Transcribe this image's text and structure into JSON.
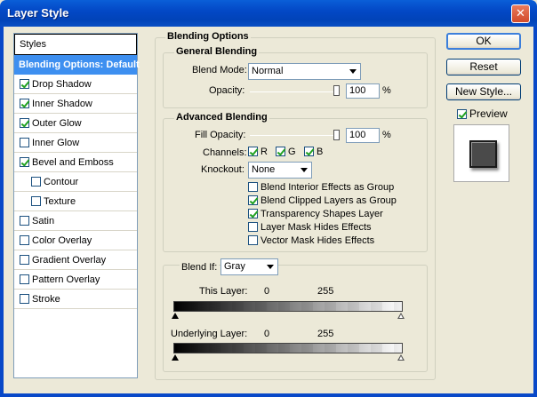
{
  "window": {
    "title": "Layer Style",
    "close_glyph": "✕"
  },
  "styles": {
    "header": "Styles",
    "items": [
      {
        "label": "Blending Options: Default",
        "selected": true
      },
      {
        "label": "Drop Shadow",
        "checked": true
      },
      {
        "label": "Inner Shadow",
        "checked": true
      },
      {
        "label": "Outer Glow",
        "checked": true
      },
      {
        "label": "Inner Glow",
        "checked": false
      },
      {
        "label": "Bevel and Emboss",
        "checked": true
      },
      {
        "label": "Contour",
        "checked": false,
        "indent": true
      },
      {
        "label": "Texture",
        "checked": false,
        "indent": true
      },
      {
        "label": "Satin",
        "checked": false
      },
      {
        "label": "Color Overlay",
        "checked": false
      },
      {
        "label": "Gradient Overlay",
        "checked": false
      },
      {
        "label": "Pattern Overlay",
        "checked": false
      },
      {
        "label": "Stroke",
        "checked": false
      }
    ]
  },
  "blending": {
    "title": "Blending Options",
    "general": {
      "title": "General Blending",
      "blend_mode_label": "Blend Mode:",
      "blend_mode_value": "Normal",
      "opacity_label": "Opacity:",
      "opacity_value": "100",
      "opacity_unit": "%",
      "opacity_level": 1.0
    },
    "advanced": {
      "title": "Advanced Blending",
      "fill_opacity_label": "Fill Opacity:",
      "fill_opacity_value": "100",
      "fill_opacity_unit": "%",
      "fill_opacity_level": 1.0,
      "channels_label": "Channels:",
      "channel_r": "R",
      "channel_g": "G",
      "channel_b": "B",
      "knockout_label": "Knockout:",
      "knockout_value": "None",
      "options": [
        {
          "label": "Blend Interior Effects as Group",
          "checked": false
        },
        {
          "label": "Blend Clipped Layers as Group",
          "checked": true
        },
        {
          "label": "Transparency Shapes Layer",
          "checked": true
        },
        {
          "label": "Layer Mask Hides Effects",
          "checked": false
        },
        {
          "label": "Vector Mask Hides Effects",
          "checked": false
        }
      ]
    },
    "blend_if": {
      "label": "Blend If:",
      "value": "Gray",
      "this_layer_label": "This Layer:",
      "this_layer_min": "0",
      "this_layer_max": "255",
      "underlying_label": "Underlying Layer:",
      "underlying_min": "0",
      "underlying_max": "255"
    }
  },
  "buttons": {
    "ok": "OK",
    "reset": "Reset",
    "new_style": "New Style...",
    "preview_label": "Preview",
    "preview_checked": true
  }
}
